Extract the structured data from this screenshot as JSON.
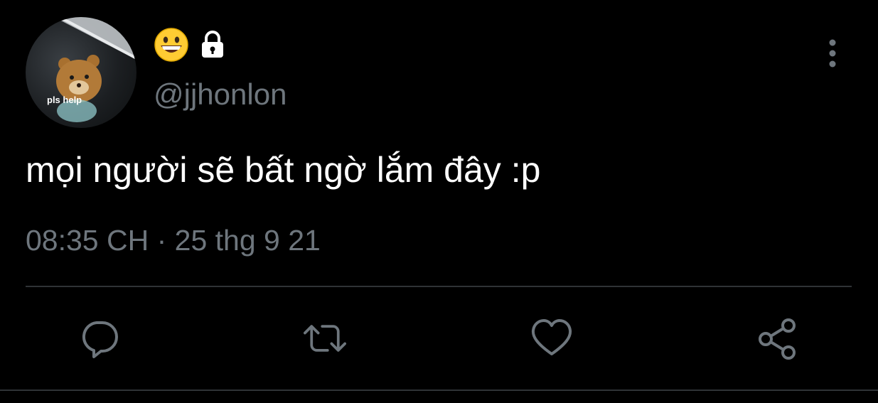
{
  "tweet": {
    "avatar_caption": "pls help",
    "display_name_emoji": "grinning-face-emoji",
    "protected_icon": "lock-icon",
    "handle": "@jjhonlon",
    "text": "mọi người sẽ bất ngờ lắm đây :p",
    "timestamp": "08:35 CH · 25 thg 9 21"
  },
  "actions": [
    {
      "name": "reply",
      "icon": "reply-icon"
    },
    {
      "name": "retweet",
      "icon": "retweet-icon"
    },
    {
      "name": "like",
      "icon": "heart-icon"
    },
    {
      "name": "share",
      "icon": "share-icon"
    }
  ],
  "colors": {
    "background": "#000000",
    "primary_text": "#ffffff",
    "secondary_text": "#6e767d",
    "divider": "#2f3336"
  }
}
